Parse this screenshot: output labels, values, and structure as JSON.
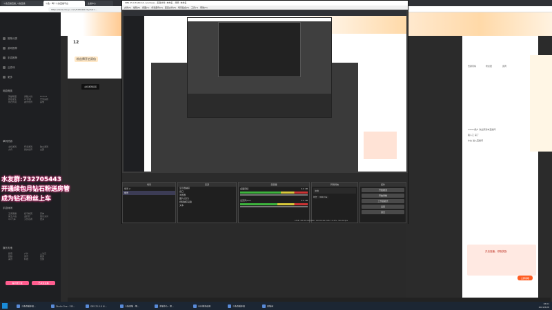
{
  "browser": {
    "tabs": [
      "斗鱼直播直播_斗鱼直播",
      "斗鱼 - 每个人的直播平台",
      "主播中心"
    ],
    "active_tab": 1,
    "url": "https://www.douyu.com/5236491?dyshid=..."
  },
  "sidebar": {
    "items": [
      {
        "icon": "home-icon",
        "label": "推荐分类"
      },
      {
        "icon": "game-icon",
        "label": "游戏推荐"
      },
      {
        "icon": "phone-icon",
        "label": "手游推荐"
      },
      {
        "icon": "tv-icon",
        "label": "云游戏"
      },
      {
        "icon": "more-icon",
        "label": "更多"
      }
    ],
    "section1_title": "网游竞技",
    "section1_items": [
      "英雄联盟",
      "穿越火线",
      "DOTA2",
      "绝地求生",
      "CF手游",
      "守望先锋",
      "炉石传说",
      "魔兽世界",
      "其他"
    ],
    "section2_title": "单机热游",
    "section2_items": [
      "主机游戏",
      "怀旧游戏",
      "独立游戏",
      "方舟",
      "我的世界",
      "全部"
    ],
    "section3_title": "手游休闲",
    "section3_items": [
      "王者荣耀",
      "和平精英",
      "原神",
      "第五人格",
      "金铲铲",
      "蛋仔派对",
      "QQ飞车",
      "火影忍者",
      "更多"
    ],
    "section4_title": "娱乐天地",
    "section4_items": [
      "颜值",
      "户外",
      "二次元",
      "舞蹈",
      "音乐",
      "星秀",
      "美食",
      "科技",
      "全部"
    ],
    "footer_buttons": [
      "客户端下载",
      "已关注主播"
    ]
  },
  "overlay": {
    "line1": "水友群:732705443",
    "line2": "开通续包月钻石粉送房管",
    "line3": "成为钻石粉丝上车"
  },
  "streamer": {
    "level": "12",
    "banner_text": "粉丝牌开启双倍",
    "video_caption": "主机游戏频道"
  },
  "obs": {
    "title": "OBS 25.0.8 (64 bit, windows) - 配置文件: 未命名 - 场景: 未命名",
    "menu": [
      "文件(F)",
      "编辑(E)",
      "视图(V)",
      "停靠部件(D)",
      "配置文件(P)",
      "场景集合(S)",
      "工具(T)",
      "帮助(H)"
    ],
    "panels": {
      "scenes": "场景",
      "sources": "来源",
      "mixer": "混音器",
      "transitions": "转场特效",
      "controls": "控件"
    },
    "scene_items": [
      "场景 2",
      "场景"
    ],
    "source_items": [
      "显示器捕获",
      "窗口",
      "浏览器",
      "图片(幻灯)",
      "视频捕获设备",
      "文本"
    ],
    "mixer_items": [
      "桌面音频",
      "麦克风/Aux"
    ],
    "mixer_values": [
      "0.0 dB",
      "0.0 dB"
    ],
    "transition_value": "淡出",
    "duration_label": "时长",
    "duration_value": "300 ms",
    "control_buttons": [
      "开始推流",
      "开始录制",
      "工作室模式",
      "设置",
      "退出"
    ],
    "status": "LIVE: 00:00:00    REC: 00:00:00    CPU: 2.4%, 30.00 fps"
  },
  "chat": {
    "title_tabs": [
      "贡献周榜",
      "粉丝团",
      "贵宾"
    ],
    "messages": [
      "admin用户 欢迎来到本直播间",
      "路人乙 来了",
      "水友 进入直播间"
    ],
    "popup_text": "开启独播，领取奖励",
    "popup_button": "立即领取"
  },
  "taskbar": {
    "items": [
      "斗鱼直播伴侣...",
      "Studio One - 510...",
      "OBS 25.0.8 (6...",
      "斗鱼直播 - 每...",
      "主播中心 - 控...",
      "OBS推流设置",
      "斗鱼直播伴侣",
      "直播间"
    ],
    "time": "18:01",
    "date": "2021/8/28"
  },
  "colors": {
    "accent": "#ff5d23",
    "overlay_glow": "#ff3b8e",
    "sidebar_bg": "#1e1f22",
    "obs_bg": "#2b2b2b"
  }
}
